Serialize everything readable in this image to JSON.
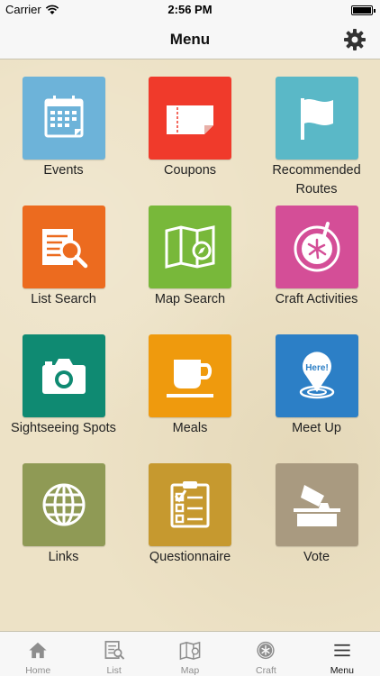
{
  "status": {
    "carrier": "Carrier",
    "time": "2:56 PM"
  },
  "nav": {
    "title": "Menu"
  },
  "tiles": [
    {
      "label": "Events",
      "icon": "calendar-icon",
      "color": "#6db3d9"
    },
    {
      "label": "Coupons",
      "icon": "ticket-icon",
      "color": "#f03a2b"
    },
    {
      "label": "Recommended Routes",
      "icon": "flag-icon",
      "color": "#5ab8c7"
    },
    {
      "label": "List Search",
      "icon": "list-search-icon",
      "color": "#ec6b1f"
    },
    {
      "label": "Map Search",
      "icon": "map-compass-icon",
      "color": "#78b83a"
    },
    {
      "label": "Craft Activities",
      "icon": "pottery-wheel-icon",
      "color": "#d44e97"
    },
    {
      "label": "Sightseeing Spots",
      "icon": "camera-icon",
      "color": "#0f8a72"
    },
    {
      "label": "Meals",
      "icon": "cup-icon",
      "color": "#ef9a0d"
    },
    {
      "label": "Meet Up",
      "icon": "here-pin-icon",
      "color": "#2c7fc6"
    },
    {
      "label": "Links",
      "icon": "globe-icon",
      "color": "#8f9a55"
    },
    {
      "label": "Questionnaire",
      "icon": "checklist-icon",
      "color": "#c6992f"
    },
    {
      "label": "Vote",
      "icon": "ballot-box-icon",
      "color": "#a99a80"
    }
  ],
  "tabs": [
    {
      "label": "Home",
      "icon": "home-icon"
    },
    {
      "label": "List",
      "icon": "list-search-icon"
    },
    {
      "label": "Map",
      "icon": "map-icon"
    },
    {
      "label": "Craft",
      "icon": "craft-icon"
    },
    {
      "label": "Menu",
      "icon": "hamburger-icon",
      "active": true
    }
  ]
}
